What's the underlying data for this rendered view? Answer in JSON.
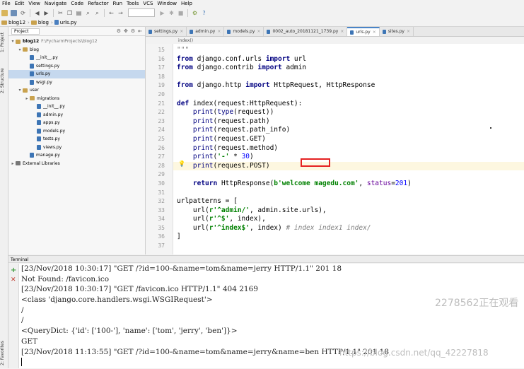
{
  "menu": [
    "File",
    "Edit",
    "View",
    "Navigate",
    "Code",
    "Refactor",
    "Run",
    "Tools",
    "VCS",
    "Window",
    "Help"
  ],
  "navbar": {
    "project": "blog12",
    "folder": "blog",
    "file": "urls.py"
  },
  "left_tabs": {
    "project": "1: Project",
    "structure": "2: Structure",
    "favorites": "2: Favorites"
  },
  "project_panel": {
    "dropdown": "Project",
    "tree": [
      {
        "label": "blog12",
        "path": "F:\\PycharmProjects\\blog12",
        "type": "folder",
        "arrow": "▾"
      },
      {
        "label": "blog",
        "type": "folder",
        "arrow": "▾"
      },
      {
        "label": "__init__.py",
        "type": "py",
        "arrow": ""
      },
      {
        "label": "settings.py",
        "type": "py",
        "arrow": ""
      },
      {
        "label": "urls.py",
        "type": "py",
        "arrow": "",
        "selected": true
      },
      {
        "label": "wsgi.py",
        "type": "py",
        "arrow": ""
      },
      {
        "label": "user",
        "type": "folder",
        "arrow": "▾"
      },
      {
        "label": "migrations",
        "type": "folder",
        "arrow": "▸"
      },
      {
        "label": "__init__.py",
        "type": "py",
        "arrow": ""
      },
      {
        "label": "admin.py",
        "type": "py",
        "arrow": ""
      },
      {
        "label": "apps.py",
        "type": "py",
        "arrow": ""
      },
      {
        "label": "models.py",
        "type": "py",
        "arrow": ""
      },
      {
        "label": "tests.py",
        "type": "py",
        "arrow": ""
      },
      {
        "label": "views.py",
        "type": "py",
        "arrow": ""
      },
      {
        "label": "manage.py",
        "type": "py",
        "arrow": ""
      },
      {
        "label": "External Libraries",
        "type": "lib",
        "arrow": "▸"
      }
    ]
  },
  "editor_tabs": [
    {
      "label": "settings.py",
      "active": false
    },
    {
      "label": "admin.py",
      "active": false
    },
    {
      "label": "models.py",
      "active": false
    },
    {
      "label": "0002_auto_20181121_1739.py",
      "active": false
    },
    {
      "label": "urls.py",
      "active": true
    },
    {
      "label": "sites.py",
      "active": false
    }
  ],
  "editor_breadcrumb": "index()",
  "code_lines": [
    {
      "n": "15",
      "html": "<span class='cmt'>\"\"\"</span>"
    },
    {
      "n": "16",
      "html": "<span class='kw'>from</span> django.conf.urls <span class='kw'>import</span> url"
    },
    {
      "n": "17",
      "html": "<span class='kw'>from</span> django.contrib <span class='kw'>import</span> admin"
    },
    {
      "n": "18",
      "html": ""
    },
    {
      "n": "19",
      "html": "<span class='kw'>from</span> django.http <span class='kw'>import</span> HttpRequest, HttpResponse"
    },
    {
      "n": "20",
      "html": ""
    },
    {
      "n": "21",
      "html": "<span class='kw'>def</span> index(request:HttpRequest):"
    },
    {
      "n": "22",
      "html": "    <span class='bi'>print</span>(<span class='bi'>type</span>(request))"
    },
    {
      "n": "23",
      "html": "    <span class='bi'>print</span>(request.path)"
    },
    {
      "n": "24",
      "html": "    <span class='bi'>print</span>(request.path_info)"
    },
    {
      "n": "25",
      "html": "    <span class='bi'>print</span>(request.GET)"
    },
    {
      "n": "26",
      "html": "    <span class='bi'>print</span>(request.method)"
    },
    {
      "n": "27",
      "html": "    <span class='bi'>print</span>(<span class='str'>'-'</span> * <span class='num'>30</span>)"
    },
    {
      "n": "28",
      "html": "    <span class='bi'>print</span>(request.POST)",
      "current": true
    },
    {
      "n": "29",
      "html": ""
    },
    {
      "n": "30",
      "html": "    <span class='kw'>return</span> HttpResponse(<span class='str'>b'welcome magedu.com'</span>, <span class='param'>status</span>=<span class='num'>201</span>)"
    },
    {
      "n": "31",
      "html": ""
    },
    {
      "n": "32",
      "html": "urlpatterns = ["
    },
    {
      "n": "33",
      "html": "    url(<span class='str'>r'^admin/'</span>, admin.site.urls),"
    },
    {
      "n": "34",
      "html": "    url(<span class='str'>r'^$'</span>, index),"
    },
    {
      "n": "35",
      "html": "    url(<span class='str'>r'^index$'</span>, index) <span class='cmt'># index index1 index/</span>"
    },
    {
      "n": "36",
      "html": "]"
    },
    {
      "n": "37",
      "html": ""
    }
  ],
  "terminal": {
    "title": "Terminal",
    "lines": [
      "[23/Nov/2018 10:30:17] \"GET /?id=100-&name=tom&name=jerry HTTP/1.1\" 201 18",
      "Not Found: /favicon.ico",
      "[23/Nov/2018 10:30:17] \"GET /favicon.ico HTTP/1.1\" 404 2169",
      "<class 'django.core.handlers.wsgi.WSGIRequest'>",
      "/",
      "/",
      "<QueryDict: {'id': ['100-'], 'name': ['tom', 'jerry', 'ben']}>",
      "GET",
      "[23/Nov/2018 11:13:55] \"GET /?id=100-&name=tom&name=jerry&name=ben HTTP/1.1\" 201 18"
    ]
  },
  "watermarks": {
    "viewers": "2278562正在观看",
    "blog": "https://blog.csdn.net/qq_42227818"
  }
}
